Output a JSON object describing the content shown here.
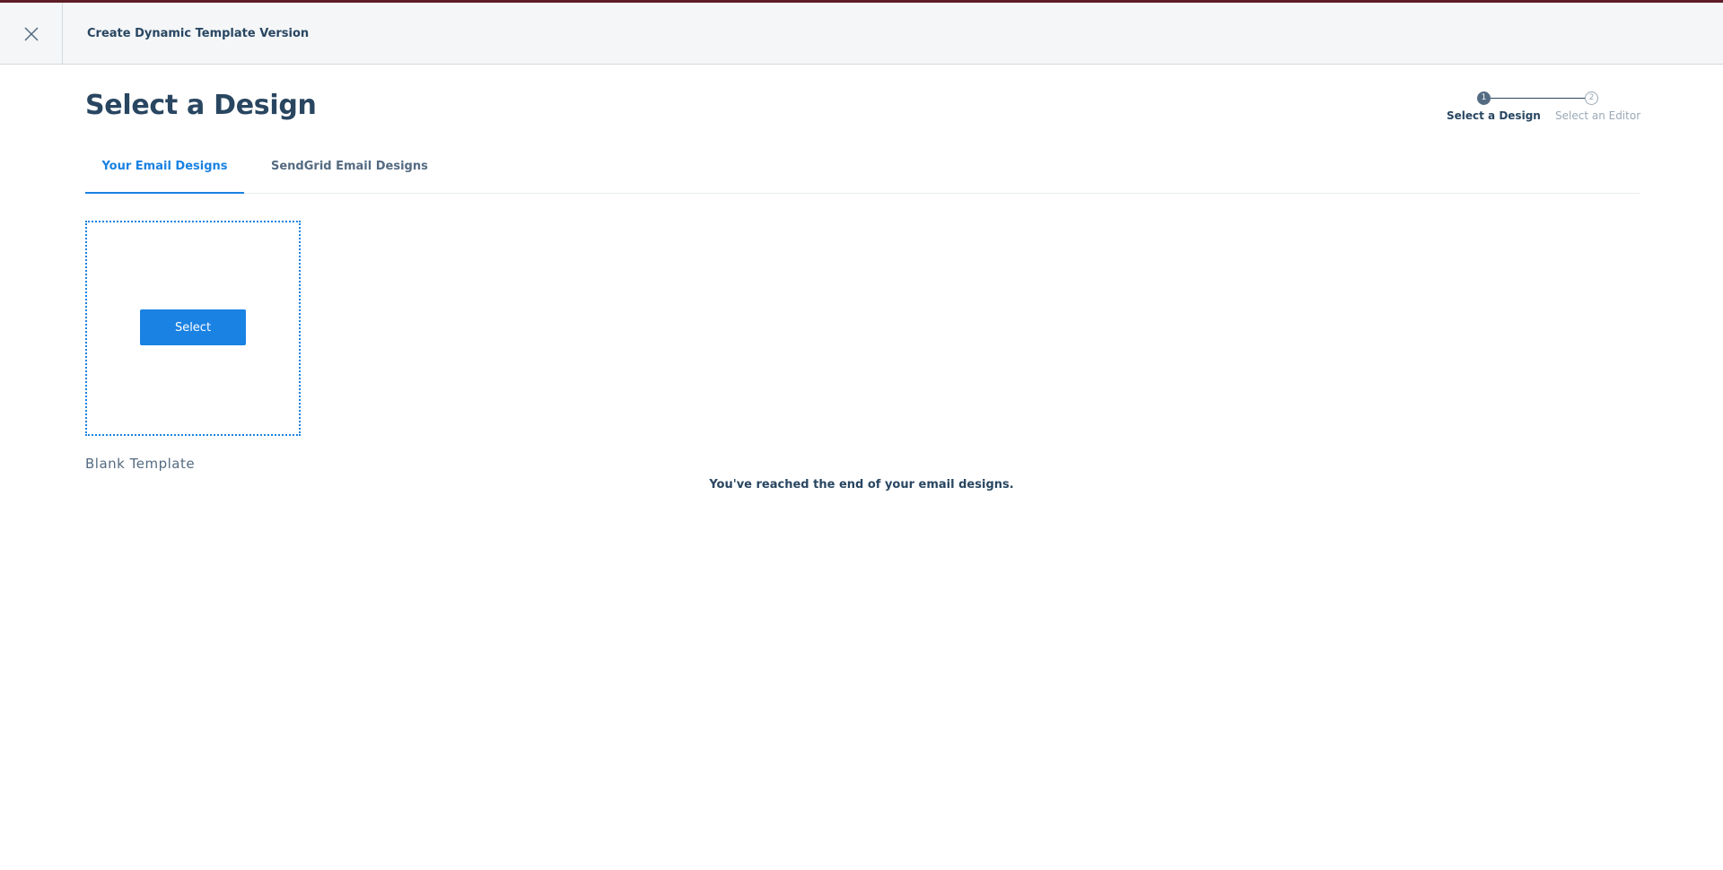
{
  "window": {
    "title": "Create Dynamic Template Version"
  },
  "icons": {
    "close": "close-icon"
  },
  "page": {
    "title": "Select a Design"
  },
  "stepper": {
    "steps": [
      {
        "number": "1",
        "label": "Select a Design",
        "state": "active"
      },
      {
        "number": "2",
        "label": "Select an Editor",
        "state": "inactive"
      }
    ]
  },
  "tabs": [
    {
      "label": "Your Email Designs",
      "active": true
    },
    {
      "label": "SendGrid Email Designs",
      "active": false
    }
  ],
  "designs": [
    {
      "name": "Blank Template",
      "button_label": "Select"
    }
  ],
  "end_message": "You've reached the end of your email designs.",
  "colors": {
    "accent": "#1a82e2",
    "text": "#294661",
    "header_bg": "#f4f6f8",
    "top_accent": "#5e1d26"
  }
}
